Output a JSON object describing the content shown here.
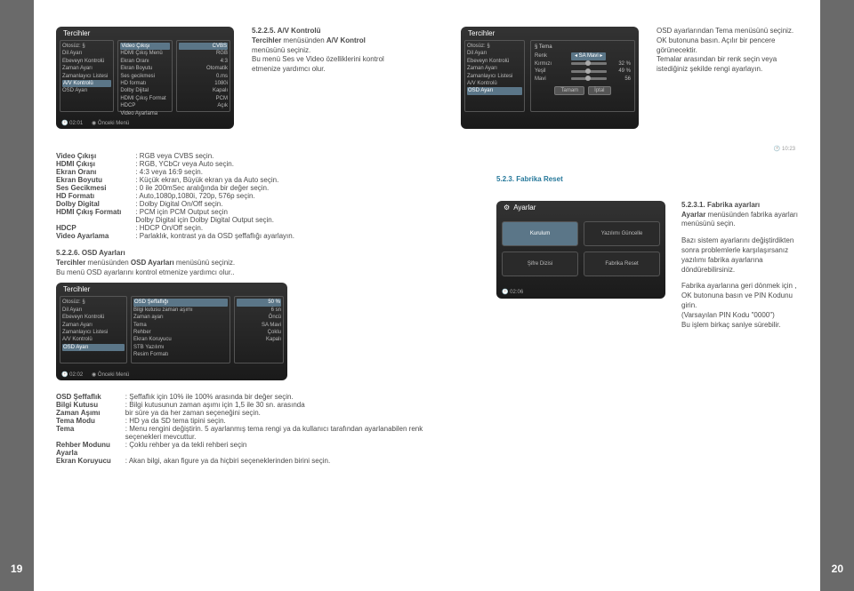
{
  "page_numbers": {
    "left": "19",
    "right": "20"
  },
  "top_left_box": {
    "title": "Tercihler",
    "left_items": [
      "Otosüz: §",
      "Dil Ayarı",
      "Ebeveyn Kontrolü",
      "Zaman Ayarı",
      "Zamanlayıcı Listesi",
      "A/V Kontrolü",
      "OSD Ayarı"
    ],
    "mid_items": [
      "Video Çıkışı",
      "HDMI Çıkış Menü",
      "Ekran Oranı",
      "Ekran Boyutu",
      "Ses gecikmesi",
      "HD formatı",
      "Dolby Dijital",
      "HDMI Çıkış Format",
      "HDCP",
      "Video Ayarlama"
    ],
    "right_items": [
      "CVBS",
      "RGB",
      "4:3",
      "Otomatik",
      "0.ms",
      "1080i",
      "Kapalı",
      "PCM",
      "Açık",
      ""
    ],
    "selected_index": 5,
    "footer_time": "🕐 02:01",
    "footer_hint": "◉ Önceki Menü"
  },
  "top_left_caption": {
    "head_num": "5.2.2.5.",
    "head_title": "A/V Kontrolü",
    "line1a": "Tercihler",
    "line1b": " menüsünden ",
    "line1c": "A/V Kontrol",
    "line1d": " menüsünü seçiniz.",
    "line2": "Bu menü Ses ve Video özelliklerini kontrol etmenize yardımcı olur."
  },
  "top_right_box": {
    "title": "Tercihler",
    "left_items": [
      "Otosüz: §",
      "Dil Ayarı",
      "Ebeveyn Kontrolü",
      "Zaman Ayarı",
      "Zamanlayıcı Listesi",
      "A/V Kontrolü",
      "OSD Ayarı"
    ],
    "r_title": "§ Tema",
    "r_line_a_lbl": "Renk",
    "r_line_a_val": "◂ SA Mavi ▸",
    "sliders": [
      {
        "lab": "Kırmızı",
        "val": "32 %"
      },
      {
        "lab": "Yeşil",
        "val": "49 %"
      },
      {
        "lab": "Mavi",
        "val": "56"
      }
    ],
    "btn1": "Tamam",
    "btn2": "İptal",
    "footer_time": "",
    "footer_hint": ""
  },
  "top_right_caption": {
    "l1": "OSD ayarlarından Tema menüsünü seçiniz.",
    "l2": "OK butonuna basın. Açılır bir pencere görünecektir.",
    "l3": "Temalar arasından bir renk seçin veya istediğiniz şekilde rengi ayarlayın."
  },
  "specs": [
    {
      "k": "Video Çıkışı",
      "v": "RGB veya CVBS seçin."
    },
    {
      "k": "HDMI Çıkışı",
      "v": "RGB, YCbCr veya Auto seçin."
    },
    {
      "k": "Ekran Oranı",
      "v": "4:3 veya 16:9 seçin."
    },
    {
      "k": "Ekran Boyutu",
      "v": "Küçük ekran, Büyük ekran ya da Auto seçin."
    },
    {
      "k": "Ses Gecikmesi",
      "v": "0 ile 200mSec aralığında bir değer seçin."
    },
    {
      "k": "HD Formatı",
      "v": "Auto,1080p,1080i, 720p, 576p seçin."
    },
    {
      "k": "Dolby Digital",
      "v": "Dolby Digital On/Off seçin."
    },
    {
      "k": "HDMI Çıkış Formatı",
      "v": "PCM için PCM Output seçin\nDolby Digital için Dolby Digital Output seçin."
    },
    {
      "k": "HDCP",
      "v": "HDCP On/Off seçin."
    },
    {
      "k": "Video Ayarlama",
      "v": "Parlaklık, kontrast ya da OSD şeffaflığı ayarlayın."
    }
  ],
  "sec526": {
    "num": "5.2.2.6.",
    "title": "OSD Ayarları",
    "l1a": "Tercihler",
    "l1b": " menüsünden ",
    "l1c": "OSD Ayarları",
    "l1d": " menüsünü seçiniz.",
    "l2": "Bu menü OSD ayarlarını kontrol etmenize yardımcı olur.."
  },
  "mid_box": {
    "title": "Tercihler",
    "left_items": [
      "Otosüz: §",
      "Dil Ayarı",
      "Ebeveyn Kontrolü",
      "Zaman Ayarı",
      "Zamanlayıcı Listesi",
      "A/V Kontrolü",
      "OSD Ayarı"
    ],
    "mid_items": [
      "OSD Şeffaflığı",
      "Bilgi kutusu zaman aşımı",
      "Zaman ayarı",
      "Tema",
      "Rehber",
      "Ekran Koruyucu",
      "STB Yazılımı",
      "Resim Formatı"
    ],
    "right_items": [
      "50 %",
      "6 sn",
      "Öncü",
      "SA Mavi",
      "Çoklu",
      "Kapalı",
      "",
      ""
    ],
    "selected_index": 6,
    "footer_time": "🕐 02:02",
    "footer_hint": "◉ Önceki Menü"
  },
  "specs2": [
    {
      "k": "OSD Şeffaflık",
      "v": "Şeffaflık için 10% ile 100% arasında bir değer seçin."
    },
    {
      "k": "Bilgi Kutusu",
      "v": "Bilgi kutusunun zaman aşımı için 1,5 ile 30 sn. arasında"
    },
    {
      "k": "Zaman Aşımı",
      "v": "bir süre ya da her zaman seçeneğini seçin.",
      "noColon": true
    },
    {
      "k": "Tema Modu",
      "v": "HD ya da SD tema tipini seçin."
    },
    {
      "k": "Tema",
      "v": "Menu rengini değiştirin. 5 ayarlanmış tema rengi ya da kullanıcı tarafından ayarlanabilen renk seçenekleri mevcuttur."
    },
    {
      "k": "Rehber Modunu",
      "v": "Çoklu rehber ya da tekli rehberi seçin"
    },
    {
      "k": "Ayarla",
      "v": "",
      "blank": true
    },
    {
      "k": "Ekran Koruyucu",
      "v": "Akan bilgi, akan figure ya da hiçbiri seçeneklerinden birini seçin."
    }
  ],
  "right_side": {
    "head523": "5.2.3. Fabrika Reset",
    "box_title": "Ayarlar",
    "tiles": [
      "Kurulum",
      "Yazılımı Güncelle",
      "Şifre Dizisi",
      "Fabrika Reset"
    ],
    "footer_time": "🕐 02:06",
    "head5231_num": "5.2.3.1.",
    "head5231_title": "Fabrika ayarları",
    "p1a": "Ayarlar",
    "p1b": " menüsünden fabrika ayarları menüsünü seçin.",
    "p2": "Bazı sistem ayarlarını değiştirdikten sonra problemlerle karşılaşırsanız yazılımı fabrika ayarlarına döndürebilirsiniz.",
    "p3": "Fabrika ayarlarına geri dönmek için , OK butonuna basın ve PIN Kodunu girin.\n(Varsayılan PIN Kodu \"0000\")\nBu işlem birkaç saniye sürebilir."
  }
}
